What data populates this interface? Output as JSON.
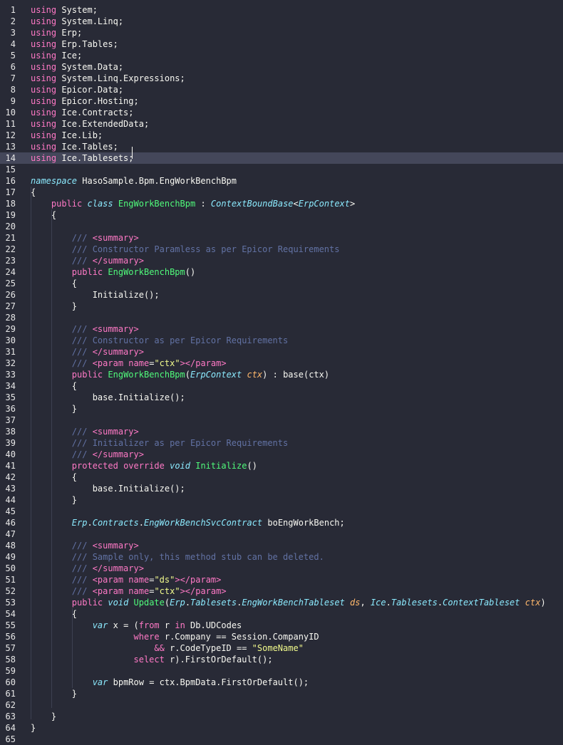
{
  "editor": {
    "language": "C#",
    "current_line": 14,
    "theme_colors": {
      "background": "#282a36",
      "current_line_bg": "#44475a",
      "keyword": "#ff79c6",
      "type": "#8be9fd",
      "function": "#50fa7b",
      "string": "#f1fa8c",
      "comment": "#6272a4",
      "parameter": "#ffb86c",
      "text": "#f8f8f2"
    },
    "lines": [
      [
        [
          "keyword",
          "using"
        ],
        [
          "plain",
          " System;"
        ]
      ],
      [
        [
          "keyword",
          "using"
        ],
        [
          "plain",
          " System.Linq;"
        ]
      ],
      [
        [
          "keyword",
          "using"
        ],
        [
          "plain",
          " Erp;"
        ]
      ],
      [
        [
          "keyword",
          "using"
        ],
        [
          "plain",
          " Erp.Tables;"
        ]
      ],
      [
        [
          "keyword",
          "using"
        ],
        [
          "plain",
          " Ice;"
        ]
      ],
      [
        [
          "keyword",
          "using"
        ],
        [
          "plain",
          " System.Data;"
        ]
      ],
      [
        [
          "keyword",
          "using"
        ],
        [
          "plain",
          " System.Linq.Expressions;"
        ]
      ],
      [
        [
          "keyword",
          "using"
        ],
        [
          "plain",
          " Epicor.Data;"
        ]
      ],
      [
        [
          "keyword",
          "using"
        ],
        [
          "plain",
          " Epicor.Hosting;"
        ]
      ],
      [
        [
          "keyword",
          "using"
        ],
        [
          "plain",
          " Ice.Contracts;"
        ]
      ],
      [
        [
          "keyword",
          "using"
        ],
        [
          "plain",
          " Ice.ExtendedData;"
        ]
      ],
      [
        [
          "keyword",
          "using"
        ],
        [
          "plain",
          " Ice.Lib;"
        ]
      ],
      [
        [
          "keyword",
          "using"
        ],
        [
          "plain",
          " Ice.Tables;"
        ]
      ],
      [
        [
          "keyword",
          "using"
        ],
        [
          "plain",
          " Ice.Tablesets;"
        ]
      ],
      [],
      [
        [
          "type",
          "namespace"
        ],
        [
          "plain",
          " HasoSample.Bpm.EngWorkBenchBpm"
        ]
      ],
      [
        [
          "plain",
          "{"
        ]
      ],
      [
        [
          "plain",
          "    "
        ],
        [
          "keyword",
          "public"
        ],
        [
          "plain",
          " "
        ],
        [
          "type",
          "class"
        ],
        [
          "plain",
          " "
        ],
        [
          "func",
          "EngWorkBenchBpm"
        ],
        [
          "plain",
          " : "
        ],
        [
          "type",
          "ContextBoundBase"
        ],
        [
          "plain",
          "<"
        ],
        [
          "type",
          "ErpContext"
        ],
        [
          "plain",
          ">"
        ]
      ],
      [
        [
          "plain",
          "    {"
        ]
      ],
      [],
      [
        [
          "plain",
          "        "
        ],
        [
          "comment",
          "/// "
        ],
        [
          "xmltag",
          "<summary>"
        ]
      ],
      [
        [
          "plain",
          "        "
        ],
        [
          "comment",
          "/// Constructor Paramless as per Epicor Requirements"
        ]
      ],
      [
        [
          "plain",
          "        "
        ],
        [
          "comment",
          "/// "
        ],
        [
          "xmltag",
          "</summary>"
        ]
      ],
      [
        [
          "plain",
          "        "
        ],
        [
          "keyword",
          "public"
        ],
        [
          "plain",
          " "
        ],
        [
          "func",
          "EngWorkBenchBpm"
        ],
        [
          "plain",
          "()"
        ]
      ],
      [
        [
          "plain",
          "        {"
        ]
      ],
      [
        [
          "plain",
          "            Initialize();"
        ]
      ],
      [
        [
          "plain",
          "        }"
        ]
      ],
      [],
      [
        [
          "plain",
          "        "
        ],
        [
          "comment",
          "/// "
        ],
        [
          "xmltag",
          "<summary>"
        ]
      ],
      [
        [
          "plain",
          "        "
        ],
        [
          "comment",
          "/// Constructor as per Epicor Requirements"
        ]
      ],
      [
        [
          "plain",
          "        "
        ],
        [
          "comment",
          "/// "
        ],
        [
          "xmltag",
          "</summary>"
        ]
      ],
      [
        [
          "plain",
          "        "
        ],
        [
          "comment",
          "/// "
        ],
        [
          "xmltag",
          "<param"
        ],
        [
          "plain",
          " "
        ],
        [
          "xmltag",
          "name"
        ],
        [
          "plain",
          "="
        ],
        [
          "string",
          "\"ctx\""
        ],
        [
          "xmltag",
          "></param>"
        ]
      ],
      [
        [
          "plain",
          "        "
        ],
        [
          "keyword",
          "public"
        ],
        [
          "plain",
          " "
        ],
        [
          "func",
          "EngWorkBenchBpm"
        ],
        [
          "plain",
          "("
        ],
        [
          "type",
          "ErpContext"
        ],
        [
          "plain",
          " "
        ],
        [
          "param",
          "ctx"
        ],
        [
          "plain",
          ") : base(ctx)"
        ]
      ],
      [
        [
          "plain",
          "        {"
        ]
      ],
      [
        [
          "plain",
          "            base.Initialize();"
        ]
      ],
      [
        [
          "plain",
          "        }"
        ]
      ],
      [],
      [
        [
          "plain",
          "        "
        ],
        [
          "comment",
          "/// "
        ],
        [
          "xmltag",
          "<summary>"
        ]
      ],
      [
        [
          "plain",
          "        "
        ],
        [
          "comment",
          "/// Initializer as per Epicor Requirements"
        ]
      ],
      [
        [
          "plain",
          "        "
        ],
        [
          "comment",
          "/// "
        ],
        [
          "xmltag",
          "</summary>"
        ]
      ],
      [
        [
          "plain",
          "        "
        ],
        [
          "keyword",
          "protected"
        ],
        [
          "plain",
          " "
        ],
        [
          "keyword",
          "override"
        ],
        [
          "plain",
          " "
        ],
        [
          "type",
          "void"
        ],
        [
          "plain",
          " "
        ],
        [
          "func",
          "Initialize"
        ],
        [
          "plain",
          "()"
        ]
      ],
      [
        [
          "plain",
          "        {"
        ]
      ],
      [
        [
          "plain",
          "            base.Initialize();"
        ]
      ],
      [
        [
          "plain",
          "        }"
        ]
      ],
      [],
      [
        [
          "plain",
          "        "
        ],
        [
          "type",
          "Erp"
        ],
        [
          "plain",
          "."
        ],
        [
          "type",
          "Contracts"
        ],
        [
          "plain",
          "."
        ],
        [
          "type",
          "EngWorkBenchSvcContract"
        ],
        [
          "plain",
          " boEngWorkBench;"
        ]
      ],
      [],
      [
        [
          "plain",
          "        "
        ],
        [
          "comment",
          "/// "
        ],
        [
          "xmltag",
          "<summary>"
        ]
      ],
      [
        [
          "plain",
          "        "
        ],
        [
          "comment",
          "/// Sample only, this method stub can be deleted."
        ]
      ],
      [
        [
          "plain",
          "        "
        ],
        [
          "comment",
          "/// "
        ],
        [
          "xmltag",
          "</summary>"
        ]
      ],
      [
        [
          "plain",
          "        "
        ],
        [
          "comment",
          "/// "
        ],
        [
          "xmltag",
          "<param"
        ],
        [
          "plain",
          " "
        ],
        [
          "xmltag",
          "name"
        ],
        [
          "plain",
          "="
        ],
        [
          "string",
          "\"ds\""
        ],
        [
          "xmltag",
          "></param>"
        ]
      ],
      [
        [
          "plain",
          "        "
        ],
        [
          "comment",
          "/// "
        ],
        [
          "xmltag",
          "<param"
        ],
        [
          "plain",
          " "
        ],
        [
          "xmltag",
          "name"
        ],
        [
          "plain",
          "="
        ],
        [
          "string",
          "\"ctx\""
        ],
        [
          "xmltag",
          "></param>"
        ]
      ],
      [
        [
          "plain",
          "        "
        ],
        [
          "keyword",
          "public"
        ],
        [
          "plain",
          " "
        ],
        [
          "type",
          "void"
        ],
        [
          "plain",
          " "
        ],
        [
          "func",
          "Update"
        ],
        [
          "plain",
          "("
        ],
        [
          "type",
          "Erp"
        ],
        [
          "plain",
          "."
        ],
        [
          "type",
          "Tablesets"
        ],
        [
          "plain",
          "."
        ],
        [
          "type",
          "EngWorkBenchTableset"
        ],
        [
          "plain",
          " "
        ],
        [
          "param",
          "ds"
        ],
        [
          "plain",
          ", "
        ],
        [
          "type",
          "Ice"
        ],
        [
          "plain",
          "."
        ],
        [
          "type",
          "Tablesets"
        ],
        [
          "plain",
          "."
        ],
        [
          "type",
          "ContextTableset"
        ],
        [
          "plain",
          " "
        ],
        [
          "param",
          "ctx"
        ],
        [
          "plain",
          ")"
        ]
      ],
      [
        [
          "plain",
          "        {"
        ]
      ],
      [
        [
          "plain",
          "            "
        ],
        [
          "type",
          "var"
        ],
        [
          "plain",
          " x = ("
        ],
        [
          "keyword",
          "from"
        ],
        [
          "plain",
          " r "
        ],
        [
          "keyword",
          "in"
        ],
        [
          "plain",
          " Db.UDCodes"
        ]
      ],
      [
        [
          "plain",
          "                    "
        ],
        [
          "keyword",
          "where"
        ],
        [
          "plain",
          " r.Company == Session.CompanyID"
        ]
      ],
      [
        [
          "plain",
          "                        "
        ],
        [
          "keyword",
          "&&"
        ],
        [
          "plain",
          " r.CodeTypeID == "
        ],
        [
          "string",
          "\"SomeName\""
        ]
      ],
      [
        [
          "plain",
          "                    "
        ],
        [
          "keyword",
          "select"
        ],
        [
          "plain",
          " r).FirstOrDefault();"
        ]
      ],
      [],
      [
        [
          "plain",
          "            "
        ],
        [
          "type",
          "var"
        ],
        [
          "plain",
          " bpmRow = ctx.BpmData.FirstOrDefault();"
        ]
      ],
      [
        [
          "plain",
          "        }"
        ]
      ],
      [],
      [
        [
          "plain",
          "    }"
        ]
      ],
      [
        [
          "plain",
          "}"
        ]
      ],
      []
    ]
  }
}
